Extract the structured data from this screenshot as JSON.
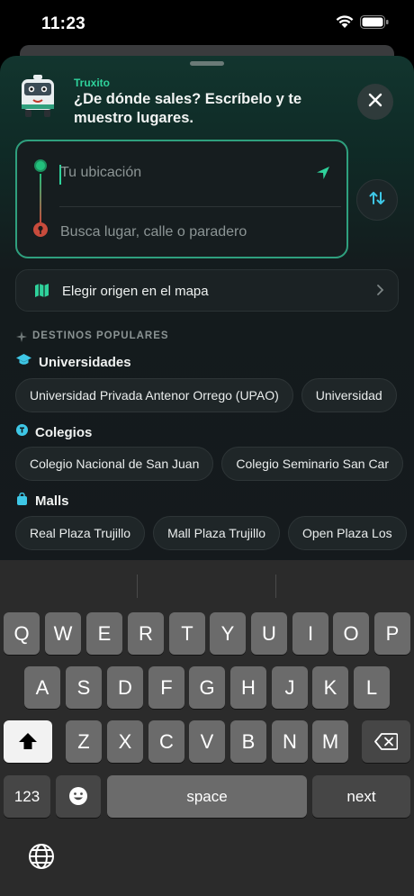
{
  "status": {
    "time": "11:23"
  },
  "header": {
    "brand": "Truxito",
    "prompt": "¿De dónde sales? Escríbelo y te muestro lugares."
  },
  "route": {
    "origin_placeholder": "Tu ubicación",
    "destination_placeholder": "Busca lugar, calle o paradero"
  },
  "map_pick": {
    "label": "Elegir origen en el mapa"
  },
  "popular": {
    "title": "DESTINOS POPULARES",
    "categories": [
      {
        "label": "Universidades",
        "icon": "graduation-cap-icon",
        "chips": [
          "Universidad Privada Antenor Orrego (UPAO)",
          "Universidad"
        ]
      },
      {
        "label": "Colegios",
        "icon": "school-icon",
        "chips": [
          "Colegio Nacional de San Juan",
          "Colegio Seminario San Car"
        ]
      },
      {
        "label": "Malls",
        "icon": "shopping-bag-icon",
        "chips": [
          "Real Plaza Trujillo",
          "Mall Plaza Trujillo",
          "Open Plaza Los"
        ]
      }
    ]
  },
  "keyboard": {
    "row1": [
      "Q",
      "W",
      "E",
      "R",
      "T",
      "Y",
      "U",
      "I",
      "O",
      "P"
    ],
    "row2": [
      "A",
      "S",
      "D",
      "F",
      "G",
      "H",
      "J",
      "K",
      "L"
    ],
    "row3": [
      "Z",
      "X",
      "C",
      "V",
      "B",
      "N",
      "M"
    ],
    "numbers_label": "123",
    "space_label": "space",
    "return_label": "next"
  },
  "colors": {
    "accent": "#2fd29b",
    "origin_dot": "#22c07c",
    "destination_pin": "#c84b3c"
  }
}
